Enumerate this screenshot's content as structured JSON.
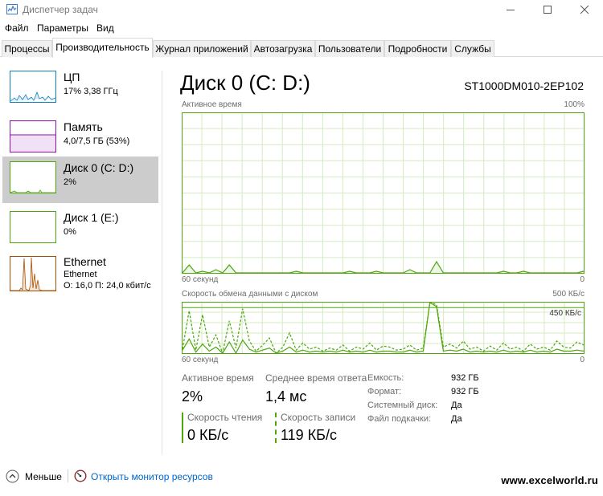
{
  "window": {
    "title": "Диспетчер задач"
  },
  "menu": [
    "Файл",
    "Параметры",
    "Вид"
  ],
  "tabs": [
    "Процессы",
    "Производительность",
    "Журнал приложений",
    "Автозагрузка",
    "Пользователи",
    "Подробности",
    "Службы"
  ],
  "resources": [
    {
      "name": "ЦП",
      "lines": [
        "17% 3,38 ГГц"
      ],
      "color": "#117dbb"
    },
    {
      "name": "Память",
      "lines": [
        "4,0/7,5 ГБ (53%)"
      ],
      "color": "#8b12ae"
    },
    {
      "name": "Диск 0 (C: D:)",
      "lines": [
        "2%"
      ],
      "color": "#4da60c"
    },
    {
      "name": "Диск 1 (E:)",
      "lines": [
        "0%"
      ],
      "color": "#4da60c"
    },
    {
      "name": "Ethernet",
      "lines": [
        "Ethernet",
        "О: 16,0 П: 24,0 кбит/с"
      ],
      "color": "#a74f01"
    }
  ],
  "detail": {
    "title": "Диск 0 (C: D:)",
    "model": "ST1000DM010-2EP102",
    "active_graph": {
      "label": "Активное время",
      "max": "100%",
      "x_left": "60 секунд",
      "x_right": "0"
    },
    "transfer_graph": {
      "label": "Скорость обмена данными с диском",
      "max": "500 КБ/с",
      "marker": "450 КБ/с",
      "x_left": "60 секунд",
      "x_right": "0"
    },
    "stats": {
      "active_time": {
        "label": "Активное время",
        "value": "2%"
      },
      "avg_response": {
        "label": "Среднее время ответа",
        "value": "1,4 мс"
      },
      "read_speed": {
        "label": "Скорость чтения",
        "value": "0 КБ/с"
      },
      "write_speed": {
        "label": "Скорость записи",
        "value": "119 КБ/с"
      }
    },
    "properties": [
      {
        "label": "Емкость:",
        "value": "932 ГБ"
      },
      {
        "label": "Формат:",
        "value": "932 ГБ"
      },
      {
        "label": "Системный диск:",
        "value": "Да"
      },
      {
        "label": "Файл подкачки:",
        "value": "Да"
      }
    ]
  },
  "footer": {
    "less": "Меньше",
    "open_monitor": "Открыть монитор ресурсов",
    "watermark": "www.excelworld.ru"
  },
  "colors": {
    "disk_line": "#4da60c",
    "disk_grid": "#d4ebc0",
    "link": "#0066cc"
  },
  "chart_data": [
    {
      "type": "area",
      "title": "Активное время",
      "xlabel": "60 секунд",
      "ylabel": "",
      "xlim": [
        60,
        0
      ],
      "ylim": [
        0,
        100
      ],
      "series": [
        {
          "values": [
            0,
            5,
            0,
            1,
            0,
            2,
            0,
            5,
            0,
            0,
            0,
            0,
            0,
            0,
            0,
            0,
            0,
            1,
            0,
            0,
            0,
            0,
            0,
            0,
            0,
            1,
            0,
            0,
            0,
            1,
            0,
            0,
            0,
            0,
            2,
            0,
            0,
            0,
            7,
            0,
            0,
            0,
            0,
            0,
            0,
            0,
            0,
            0,
            1,
            0,
            0,
            1,
            0,
            0,
            0,
            0,
            0,
            0,
            0,
            0,
            1
          ]
        }
      ]
    },
    {
      "type": "line",
      "title": "Скорость обмена данными с диском",
      "xlabel": "60 секунд",
      "ylabel": "",
      "xlim": [
        60,
        0
      ],
      "ylim": [
        0,
        500
      ],
      "series": [
        {
          "values": [
            40,
            420,
            30,
            380,
            60,
            180,
            0,
            320,
            50,
            440,
            120,
            20,
            80,
            150,
            0,
            60,
            200,
            30,
            100,
            40,
            60,
            20,
            50,
            30,
            80,
            20,
            60,
            40,
            100,
            30,
            70,
            60,
            30,
            40,
            80,
            30,
            50,
            500,
            480,
            60,
            90,
            50,
            120,
            40,
            60,
            20,
            70,
            30,
            100,
            40,
            60,
            20,
            90,
            40,
            60,
            30,
            120,
            60,
            50,
            110,
            80
          ]
        },
        {
          "values": [
            30,
            140,
            10,
            90,
            20,
            60,
            0,
            110,
            0,
            130,
            40,
            10,
            30,
            50,
            0,
            20,
            60,
            10,
            30,
            10,
            20,
            10,
            20,
            10,
            30,
            10,
            20,
            10,
            30,
            10,
            20,
            20,
            10,
            10,
            30,
            10,
            20,
            500,
            460,
            20,
            30,
            20,
            40,
            10,
            20,
            10,
            20,
            10,
            30,
            10,
            20,
            10,
            30,
            10,
            20,
            10,
            40,
            20,
            20,
            30,
            20
          ]
        }
      ]
    }
  ]
}
